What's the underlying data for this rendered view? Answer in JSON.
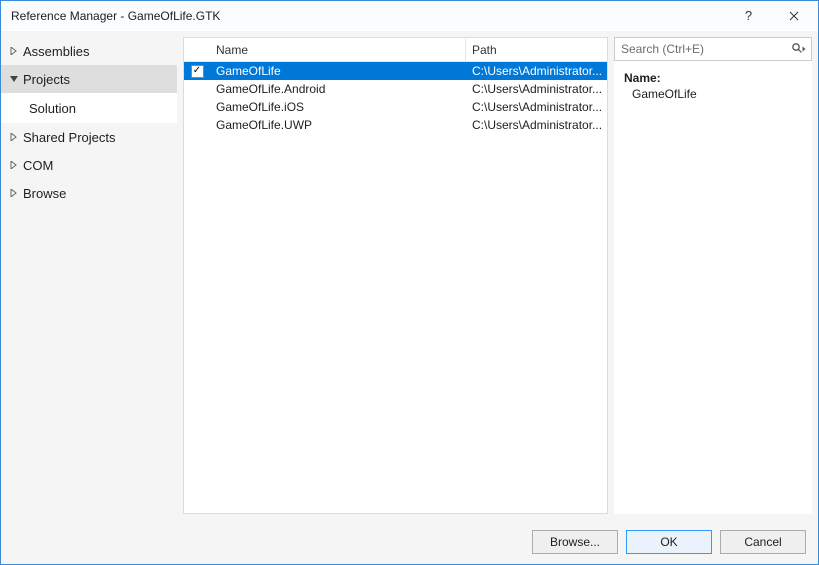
{
  "window": {
    "title": "Reference Manager - GameOfLife.GTK"
  },
  "search": {
    "placeholder": "Search (Ctrl+E)"
  },
  "sidebar": {
    "items": [
      {
        "label": "Assemblies",
        "expanded": false
      },
      {
        "label": "Projects",
        "expanded": true,
        "sub": [
          {
            "label": "Solution"
          }
        ]
      },
      {
        "label": "Shared Projects",
        "expanded": false
      },
      {
        "label": "COM",
        "expanded": false
      },
      {
        "label": "Browse",
        "expanded": false
      }
    ]
  },
  "list": {
    "columns": {
      "name": "Name",
      "path": "Path"
    },
    "rows": [
      {
        "checked": true,
        "selected": true,
        "name": "GameOfLife",
        "path": "C:\\Users\\Administrator..."
      },
      {
        "checked": false,
        "selected": false,
        "name": "GameOfLife.Android",
        "path": "C:\\Users\\Administrator..."
      },
      {
        "checked": false,
        "selected": false,
        "name": "GameOfLife.iOS",
        "path": "C:\\Users\\Administrator..."
      },
      {
        "checked": false,
        "selected": false,
        "name": "GameOfLife.UWP",
        "path": "C:\\Users\\Administrator..."
      }
    ]
  },
  "detail": {
    "label": "Name:",
    "value": "GameOfLife"
  },
  "footer": {
    "browse": "Browse...",
    "ok": "OK",
    "cancel": "Cancel"
  }
}
